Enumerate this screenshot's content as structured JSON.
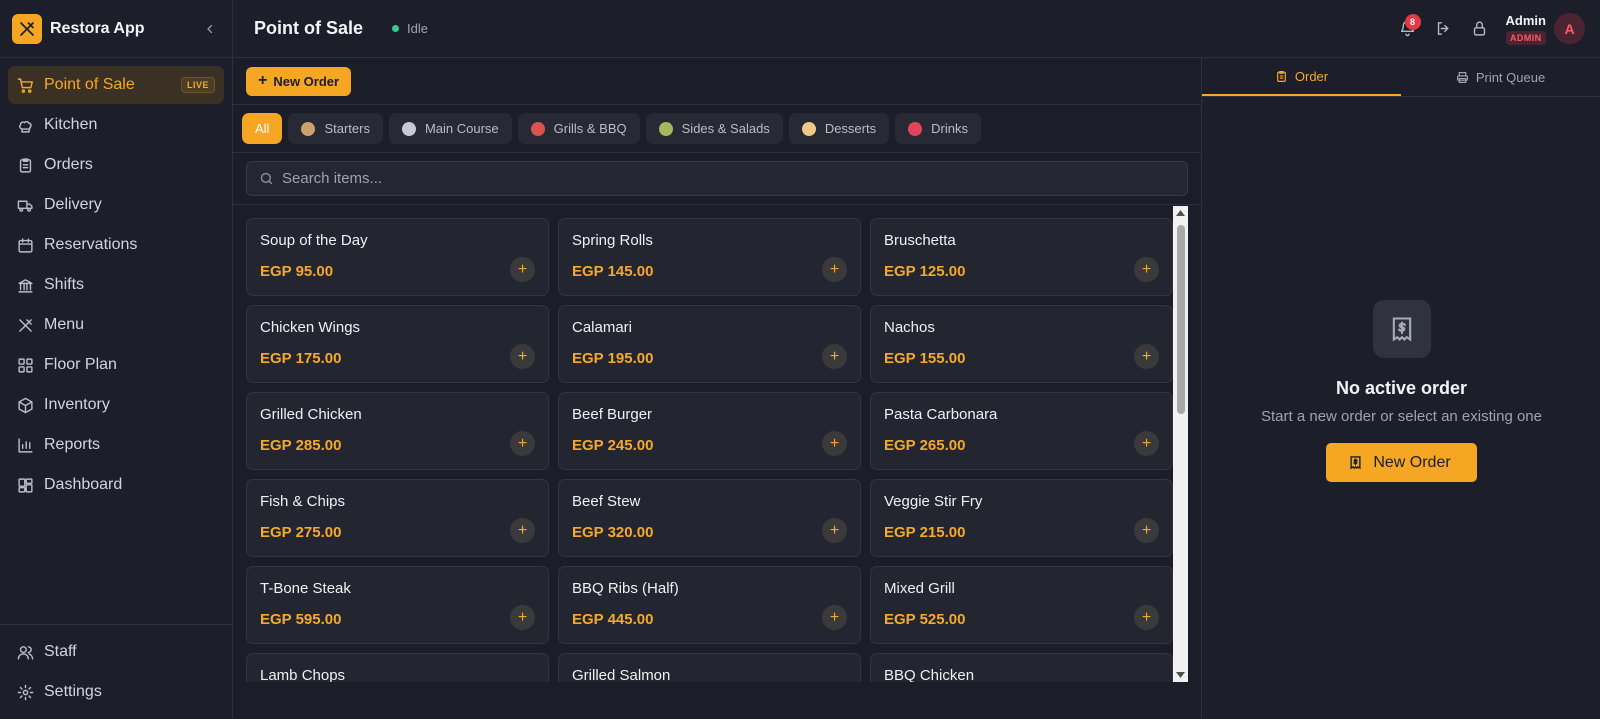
{
  "brand": {
    "name": "Restora App"
  },
  "nav": [
    {
      "label": "Point of Sale",
      "icon": "cart-icon",
      "active": true,
      "badge": "LIVE"
    },
    {
      "label": "Kitchen",
      "icon": "chef-hat-icon"
    },
    {
      "label": "Orders",
      "icon": "clipboard-icon"
    },
    {
      "label": "Delivery",
      "icon": "truck-icon"
    },
    {
      "label": "Reservations",
      "icon": "calendar-icon"
    },
    {
      "label": "Shifts",
      "icon": "bank-icon"
    },
    {
      "label": "Menu",
      "icon": "utensils-icon"
    },
    {
      "label": "Floor Plan",
      "icon": "grid-icon"
    },
    {
      "label": "Inventory",
      "icon": "box-icon"
    },
    {
      "label": "Reports",
      "icon": "bar-chart-icon"
    },
    {
      "label": "Dashboard",
      "icon": "dashboard-icon"
    }
  ],
  "nav_bottom": [
    {
      "label": "Staff",
      "icon": "users-icon"
    },
    {
      "label": "Settings",
      "icon": "gear-icon"
    }
  ],
  "header": {
    "title": "Point of Sale",
    "status": "Idle",
    "notification_count": "8",
    "user_name": "Admin",
    "user_role": "ADMIN",
    "avatar_initial": "A"
  },
  "toolbar": {
    "new_order_label": "New Order"
  },
  "categories": [
    {
      "label": "All",
      "active": true
    },
    {
      "label": "Starters",
      "color": "#c9a26b"
    },
    {
      "label": "Main Course",
      "color": "#c7c9d6"
    },
    {
      "label": "Grills & BBQ",
      "color": "#d9534f"
    },
    {
      "label": "Sides & Salads",
      "color": "#a7b85c"
    },
    {
      "label": "Desserts",
      "color": "#f1c987"
    },
    {
      "label": "Drinks",
      "color": "#e0455b"
    }
  ],
  "search": {
    "placeholder": "Search items..."
  },
  "items": [
    {
      "name": "Soup of the Day",
      "price": "EGP 95.00"
    },
    {
      "name": "Spring Rolls",
      "price": "EGP 145.00"
    },
    {
      "name": "Bruschetta",
      "price": "EGP 125.00"
    },
    {
      "name": "Chicken Wings",
      "price": "EGP 175.00"
    },
    {
      "name": "Calamari",
      "price": "EGP 195.00"
    },
    {
      "name": "Nachos",
      "price": "EGP 155.00"
    },
    {
      "name": "Grilled Chicken",
      "price": "EGP 285.00"
    },
    {
      "name": "Beef Burger",
      "price": "EGP 245.00"
    },
    {
      "name": "Pasta Carbonara",
      "price": "EGP 265.00"
    },
    {
      "name": "Fish & Chips",
      "price": "EGP 275.00"
    },
    {
      "name": "Beef Stew",
      "price": "EGP 320.00"
    },
    {
      "name": "Veggie Stir Fry",
      "price": "EGP 215.00"
    },
    {
      "name": "T-Bone Steak",
      "price": "EGP 595.00"
    },
    {
      "name": "BBQ Ribs (Half)",
      "price": "EGP 445.00"
    },
    {
      "name": "Mixed Grill",
      "price": "EGP 525.00"
    },
    {
      "name": "Lamb Chops",
      "price": ""
    },
    {
      "name": "Grilled Salmon",
      "price": ""
    },
    {
      "name": "BBQ Chicken",
      "price": ""
    }
  ],
  "panel": {
    "tabs": [
      {
        "label": "Order",
        "active": true
      },
      {
        "label": "Print Queue"
      }
    ],
    "empty_title": "No active order",
    "empty_subtitle": "Start a new order or select an existing one",
    "empty_button": "New Order"
  },
  "colors": {
    "accent": "#f5a623",
    "danger": "#e53946",
    "online": "#2fcf8a"
  }
}
